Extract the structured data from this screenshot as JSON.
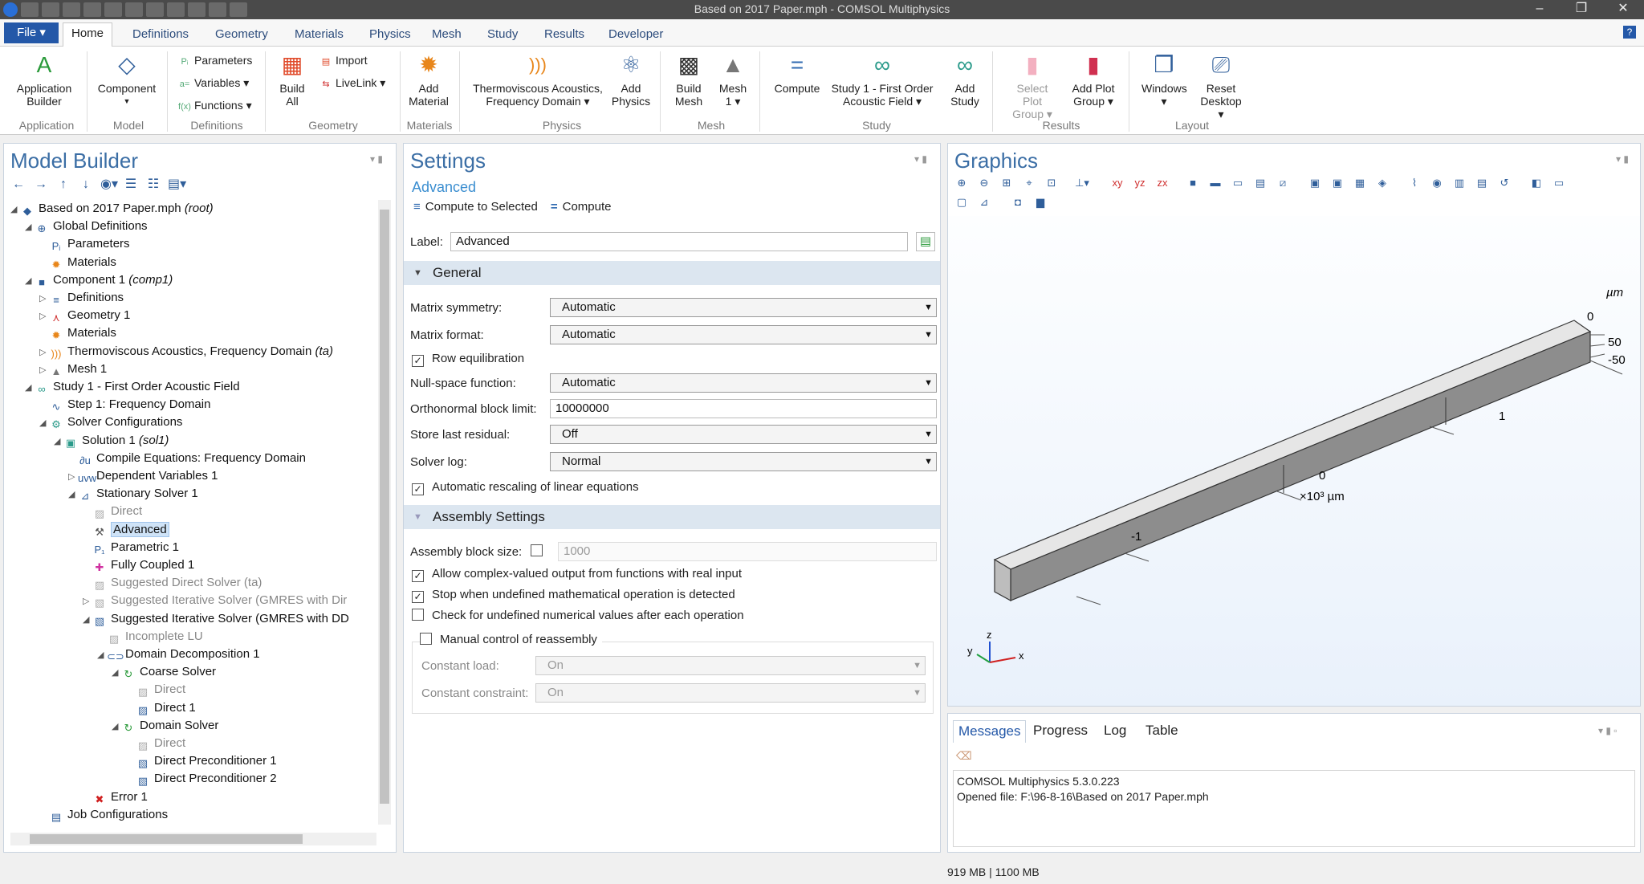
{
  "window": {
    "title": "Based on 2017 Paper.mph - COMSOL Multiphysics",
    "controls": [
      "–",
      "❐",
      "✕"
    ]
  },
  "tabs": {
    "file": "File ▾",
    "items": [
      "Home",
      "Definitions",
      "Geometry",
      "Materials",
      "Physics",
      "Mesh",
      "Study",
      "Results",
      "Developer"
    ],
    "help": "?"
  },
  "ribbon": {
    "app_builder": "Application Builder",
    "component": "Component",
    "parameters": "Parameters",
    "variables": "Variables ▾",
    "functions": "Functions ▾",
    "build_all": "Build All",
    "import": "Import",
    "livelink": "LiveLink ▾",
    "add_material": "Add Material",
    "thermoviscous": "Thermoviscous Acoustics, Frequency Domain ▾",
    "add_physics": "Add Physics",
    "build_mesh": "Build Mesh",
    "mesh1": "Mesh 1 ▾",
    "compute": "Compute",
    "study1": "Study 1 - First Order Acoustic Field ▾",
    "add_study": "Add Study",
    "select_plot_group": "Select Plot Group ▾",
    "add_plot_group": "Add Plot Group ▾",
    "windows": "Windows ▾",
    "reset_desktop": "Reset Desktop ▾",
    "groups": [
      "Application",
      "Model",
      "Definitions",
      "Geometry",
      "Materials",
      "Physics",
      "Mesh",
      "Study",
      "Results",
      "Layout"
    ]
  },
  "model_builder": {
    "title": "Model Builder",
    "tree": [
      {
        "text": "Based on 2017 Paper.mph ",
        "italic": "(root)",
        "level": 0,
        "tw": "◢",
        "icon": "root-icon",
        "glyph": "◆",
        "color": "#2f5e9a"
      },
      {
        "text": "Global Definitions",
        "italic": "",
        "level": 1,
        "tw": "◢",
        "icon": "globe-icon",
        "glyph": "⊕",
        "color": "#2f5e9a"
      },
      {
        "text": "Parameters",
        "italic": "",
        "level": 2,
        "tw": "",
        "icon": "parameters-icon",
        "glyph": "Pᵢ",
        "color": "#2f5e9a"
      },
      {
        "text": "Materials",
        "italic": "",
        "level": 2,
        "tw": "",
        "icon": "materials-icon",
        "glyph": "✹",
        "color": "#e8861a"
      },
      {
        "text": "Component 1 ",
        "italic": "(comp1)",
        "level": 1,
        "tw": "◢",
        "icon": "component-icon",
        "glyph": "■",
        "color": "#2f5e9a"
      },
      {
        "text": "Definitions",
        "italic": "",
        "level": 2,
        "tw": "▷",
        "icon": "definitions-icon",
        "glyph": "≡",
        "color": "#2f5e9a"
      },
      {
        "text": "Geometry 1",
        "italic": "",
        "level": 2,
        "tw": "▷",
        "icon": "geometry-icon",
        "glyph": "⋏",
        "color": "#d03030"
      },
      {
        "text": "Materials",
        "italic": "",
        "level": 2,
        "tw": "",
        "icon": "materials-icon",
        "glyph": "✹",
        "color": "#e8861a"
      },
      {
        "text": "Thermoviscous Acoustics, Frequency Domain ",
        "italic": "(ta)",
        "level": 2,
        "tw": "▷",
        "icon": "acoustics-icon",
        "glyph": ")))",
        "color": "#e8861a"
      },
      {
        "text": "Mesh 1",
        "italic": "",
        "level": 2,
        "tw": "▷",
        "icon": "mesh-icon",
        "glyph": "▲",
        "color": "#777"
      },
      {
        "text": "Study 1 - First Order Acoustic Field",
        "italic": "",
        "level": 1,
        "tw": "◢",
        "icon": "study-icon",
        "glyph": "∞",
        "color": "#2a9a8a"
      },
      {
        "text": "Step 1: Frequency Domain",
        "italic": "",
        "level": 2,
        "tw": "",
        "icon": "step-icon",
        "glyph": "∿",
        "color": "#2f5e9a"
      },
      {
        "text": "Solver Configurations",
        "italic": "",
        "level": 2,
        "tw": "◢",
        "icon": "solver-config-icon",
        "glyph": "⚙",
        "color": "#2a9a8a"
      },
      {
        "text": "Solution 1 ",
        "italic": "(sol1)",
        "level": 3,
        "tw": "◢",
        "icon": "solution-icon",
        "glyph": "▣",
        "color": "#2a9a8a"
      },
      {
        "text": "Compile Equations: Frequency Domain",
        "italic": "",
        "level": 4,
        "tw": "",
        "icon": "compile-icon",
        "glyph": "∂u",
        "color": "#2f5e9a"
      },
      {
        "text": "Dependent Variables 1",
        "italic": "",
        "level": 4,
        "tw": "▷",
        "icon": "variables-icon",
        "glyph": "uvw",
        "color": "#2f5e9a"
      },
      {
        "text": "Stationary Solver 1",
        "italic": "",
        "level": 4,
        "tw": "◢",
        "icon": "stationary-icon",
        "glyph": "⊿",
        "color": "#2f5e9a"
      },
      {
        "text": "Direct",
        "italic": "",
        "level": 5,
        "tw": "",
        "icon": "direct-icon",
        "glyph": "▨",
        "color": "#aaa",
        "gray": true
      },
      {
        "text": "Advanced",
        "italic": "",
        "level": 5,
        "tw": "",
        "icon": "advanced-icon",
        "glyph": "⚒",
        "color": "#555",
        "selected": true
      },
      {
        "text": "Parametric 1",
        "italic": "",
        "level": 5,
        "tw": "",
        "icon": "parametric-icon",
        "glyph": "P₁",
        "color": "#2f5e9a"
      },
      {
        "text": "Fully Coupled 1",
        "italic": "",
        "level": 5,
        "tw": "",
        "icon": "coupled-icon",
        "glyph": "✚",
        "color": "#d030a0"
      },
      {
        "text": "Suggested Direct Solver (ta)",
        "italic": "",
        "level": 5,
        "tw": "",
        "icon": "direct-icon",
        "glyph": "▨",
        "color": "#aaa",
        "gray": true
      },
      {
        "text": "Suggested Iterative Solver (GMRES with Dir",
        "italic": "",
        "level": 5,
        "tw": "▷",
        "icon": "iterative-icon",
        "glyph": "▧",
        "color": "#aaa",
        "gray": true
      },
      {
        "text": "Suggested Iterative Solver (GMRES with DD",
        "italic": "",
        "level": 5,
        "tw": "◢",
        "icon": "iterative-icon",
        "glyph": "▧",
        "color": "#2f5e9a"
      },
      {
        "text": "Incomplete LU",
        "italic": "",
        "level": 6,
        "tw": "",
        "icon": "lu-icon",
        "glyph": "▨",
        "color": "#aaa",
        "gray": true
      },
      {
        "text": "Domain Decomposition 1",
        "italic": "",
        "level": 6,
        "tw": "◢",
        "icon": "domain-decomp-icon",
        "glyph": "⊂⊃",
        "color": "#2f5e9a"
      },
      {
        "text": "Coarse Solver",
        "italic": "",
        "level": 7,
        "tw": "◢",
        "icon": "cycle-icon",
        "glyph": "↻",
        "color": "#2a9a3a"
      },
      {
        "text": "Direct",
        "italic": "",
        "level": 8,
        "tw": "",
        "icon": "direct-icon",
        "glyph": "▨",
        "color": "#aaa",
        "gray": true
      },
      {
        "text": "Direct 1",
        "italic": "",
        "level": 8,
        "tw": "",
        "icon": "direct-icon",
        "glyph": "▨",
        "color": "#2f5e9a"
      },
      {
        "text": "Domain Solver",
        "italic": "",
        "level": 7,
        "tw": "◢",
        "icon": "cycle-icon",
        "glyph": "↻",
        "color": "#2a9a3a"
      },
      {
        "text": "Direct",
        "italic": "",
        "level": 8,
        "tw": "",
        "icon": "direct-icon",
        "glyph": "▨",
        "color": "#aaa",
        "gray": true
      },
      {
        "text": "Direct Preconditioner 1",
        "italic": "",
        "level": 8,
        "tw": "",
        "icon": "preconditioner-icon",
        "glyph": "▧",
        "color": "#2f5e9a"
      },
      {
        "text": "Direct Preconditioner 2",
        "italic": "",
        "level": 8,
        "tw": "",
        "icon": "preconditioner-icon",
        "glyph": "▧",
        "color": "#2f5e9a"
      },
      {
        "text": "Error 1",
        "italic": "",
        "level": 5,
        "tw": "",
        "icon": "error-icon",
        "glyph": "✖",
        "color": "#d02020"
      },
      {
        "text": "Job Configurations",
        "italic": "",
        "level": 2,
        "tw": "",
        "icon": "job-icon",
        "glyph": "▤",
        "color": "#2f5e9a"
      }
    ]
  },
  "settings": {
    "title": "Settings",
    "subtitle": "Advanced",
    "compute_selected": "Compute to Selected",
    "compute": "Compute",
    "label_label": "Label:",
    "label_value": "Advanced",
    "general": "General",
    "matrix_symmetry_label": "Matrix symmetry:",
    "matrix_symmetry": "Automatic",
    "matrix_format_label": "Matrix format:",
    "matrix_format": "Automatic",
    "row_equilibration": "Row equilibration",
    "null_space_label": "Null-space function:",
    "null_space": "Automatic",
    "ortho_label": "Orthonormal block limit:",
    "ortho_value": "10000000",
    "store_residual_label": "Store last residual:",
    "store_residual": "Off",
    "solver_log_label": "Solver log:",
    "solver_log": "Normal",
    "auto_rescaling": "Automatic rescaling of linear equations",
    "assembly": "Assembly Settings",
    "block_size_label": "Assembly block size:",
    "block_size_value": "1000",
    "allow_complex": "Allow complex-valued output from functions with real input",
    "stop_undefined": "Stop when undefined mathematical operation is detected",
    "check_undefined": "Check for undefined numerical values after each operation",
    "manual_reassembly": "Manual control of reassembly",
    "const_load_label": "Constant load:",
    "const_load": "On",
    "const_constraint_label": "Constant constraint:",
    "const_constraint": "On"
  },
  "graphics": {
    "title": "Graphics",
    "unit_um": "µm",
    "tick_0": "0",
    "tick_50": "50",
    "tick_m50": "-50",
    "tick_1": "1",
    "tick_0x": "0",
    "scale": "×10³ µm",
    "tick_m1": "-1",
    "axis_z": "z",
    "axis_y": "y",
    "axis_x": "x"
  },
  "messages": {
    "tabs": [
      "Messages",
      "Progress",
      "Log",
      "Table"
    ],
    "lines": [
      "COMSOL Multiphysics 5.3.0.223",
      "Opened file: F:\\96-8-16\\Based on 2017 Paper.mph"
    ]
  },
  "status": {
    "memory": "919 MB | 1100 MB"
  }
}
